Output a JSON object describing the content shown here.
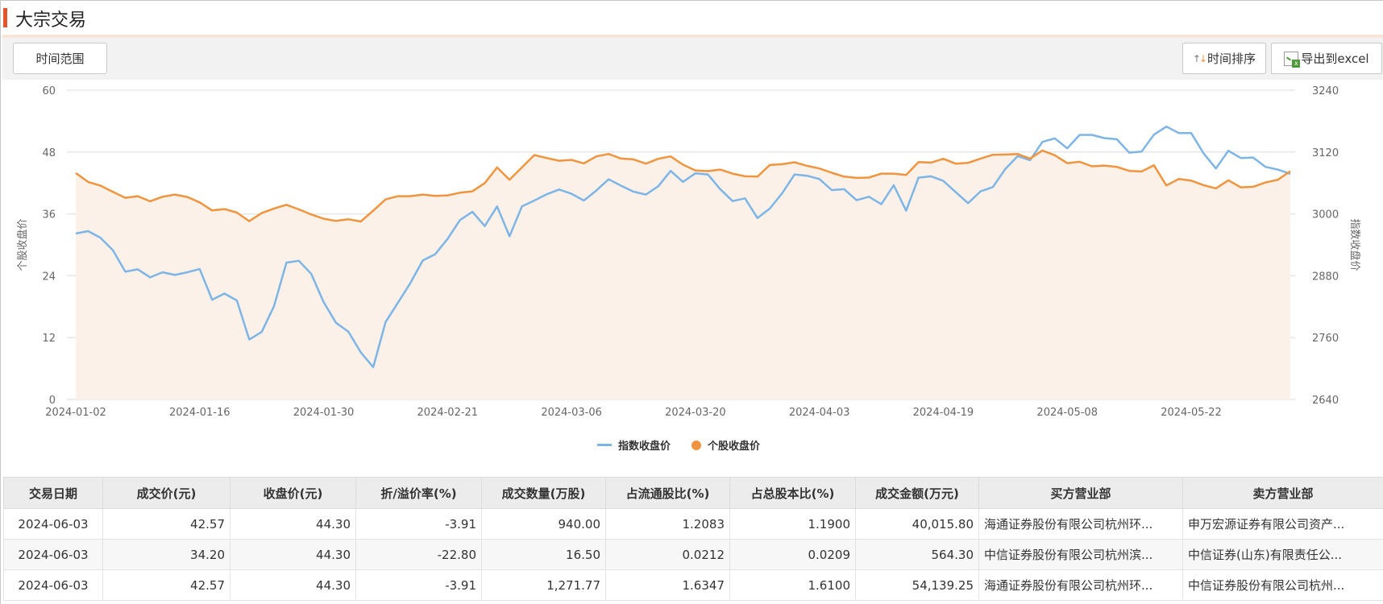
{
  "header": {
    "title": "大宗交易"
  },
  "toolbar": {
    "time_range_label": "时间范围",
    "sort_label": "时间排序",
    "export_label": "导出到excel"
  },
  "colors": {
    "accent": "#e2552a",
    "index_line": "#7cb5e6",
    "stock_line": "#f0943e",
    "stock_area": "#fcf1e8"
  },
  "chart_data": {
    "type": "line",
    "left_axis": {
      "title": "个股收盘价",
      "range": [
        0,
        60
      ],
      "ticks": [
        "0",
        "12",
        "24",
        "36",
        "48",
        "60"
      ]
    },
    "right_axis": {
      "title": "指数收盘价",
      "range": [
        2640,
        3240
      ],
      "ticks": [
        "2640",
        "2760",
        "2880",
        "3000",
        "3120",
        "3240"
      ]
    },
    "x_ticks": [
      "2024-01-02",
      "2024-01-16",
      "2024-01-30",
      "2024-02-21",
      "2024-03-06",
      "2024-03-20",
      "2024-04-03",
      "2024-04-19",
      "2024-05-08",
      "2024-05-22"
    ],
    "x_tick_interval": 10,
    "grid": true,
    "legend": {
      "position": "bottom-center",
      "items": [
        "指数收盘价",
        "个股收盘价"
      ]
    },
    "series": [
      {
        "name": "指数收盘价",
        "axis": "right",
        "values": [
          2961.8,
          2966.5,
          2953.5,
          2929.5,
          2887.8,
          2892.5,
          2876.8,
          2886.7,
          2881.5,
          2886.7,
          2893.0,
          2833.5,
          2845.5,
          2832.0,
          2756.3,
          2770.9,
          2821.0,
          2905.5,
          2909.1,
          2883.6,
          2828.8,
          2788.7,
          2771.4,
          2731.2,
          2702.6,
          2790.2,
          2827.8,
          2865.9,
          2909.7,
          2921.7,
          2951.4,
          2987.9,
          3004.1,
          2976.4,
          3014.5,
          2956.6,
          3014.5,
          3026.0,
          3038.0,
          3047.4,
          3039.0,
          3026.0,
          3045.3,
          3067.2,
          3054.7,
          3043.2,
          3037.5,
          3053.6,
          3083.4,
          3062.0,
          3078.7,
          3076.6,
          3047.9,
          3024.9,
          3030.2,
          2992.1,
          3010.3,
          3040.1,
          3076.6,
          3074.0,
          3067.7,
          3046.3,
          3047.9,
          3026.5,
          3033.3,
          3018.7,
          3055.7,
          3006.2,
          3070.3,
          3072.9,
          3064.1,
          3042.2,
          3020.8,
          3043.7,
          3052.1,
          3087.0,
          3112.0,
          3104.2,
          3139.7,
          3146.5,
          3127.2,
          3153.3,
          3153.3,
          3147.0,
          3144.9,
          3118.9,
          3120.9,
          3153.8,
          3169.4,
          3156.9,
          3156.9,
          3117.3,
          3088.1,
          3122.5,
          3108.4,
          3109.4,
          3091.2,
          3086.0,
          3077.6
        ]
      },
      {
        "name": "个股收盘价",
        "axis": "left",
        "values": [
          43.92,
          42.2,
          41.47,
          40.27,
          39.12,
          39.44,
          38.45,
          39.33,
          39.75,
          39.28,
          38.24,
          36.67,
          36.93,
          36.25,
          34.59,
          36.15,
          37.04,
          37.77,
          36.88,
          35.89,
          35.06,
          34.64,
          34.95,
          34.53,
          36.62,
          38.81,
          39.44,
          39.44,
          39.75,
          39.49,
          39.59,
          40.11,
          40.38,
          41.99,
          45.02,
          42.62,
          45.02,
          47.42,
          46.84,
          46.32,
          46.48,
          45.8,
          47.16,
          47.63,
          46.74,
          46.58,
          45.75,
          46.69,
          47.16,
          45.54,
          44.44,
          44.29,
          44.6,
          43.82,
          43.3,
          43.24,
          45.49,
          45.64,
          46.01,
          45.33,
          44.81,
          43.98,
          43.24,
          42.98,
          43.04,
          43.82,
          43.82,
          43.56,
          46.06,
          45.96,
          46.69,
          45.75,
          45.91,
          46.74,
          47.47,
          47.52,
          47.63,
          46.74,
          48.3,
          47.37,
          45.85,
          46.11,
          45.23,
          45.38,
          45.12,
          44.34,
          44.24,
          45.44,
          41.52,
          42.78,
          42.46,
          41.58,
          40.95,
          42.51,
          41.16,
          41.26,
          42.1,
          42.62,
          44.3
        ]
      }
    ]
  },
  "table": {
    "headers": [
      "交易日期",
      "成交价(元)",
      "收盘价(元)",
      "折/溢价率(%)",
      "成交数量(万股)",
      "占流通股比(%)",
      "占总股本比(%)",
      "成交金额(万元)",
      "买方营业部",
      "卖方营业部"
    ],
    "rows": [
      [
        "2024-06-03",
        "42.57",
        "44.30",
        "-3.91",
        "940.00",
        "1.2083",
        "1.1900",
        "40,015.80",
        "海通证券股份有限公司杭州环...",
        "申万宏源证券有限公司资产..."
      ],
      [
        "2024-06-03",
        "34.20",
        "44.30",
        "-22.80",
        "16.50",
        "0.0212",
        "0.0209",
        "564.30",
        "中信证券股份有限公司杭州滨...",
        "中信证券(山东)有限责任公..."
      ],
      [
        "2024-06-03",
        "42.57",
        "44.30",
        "-3.91",
        "1,271.77",
        "1.6347",
        "1.6100",
        "54,139.25",
        "海通证券股份有限公司杭州环...",
        "中信证券股份有限公司杭州..."
      ]
    ]
  }
}
